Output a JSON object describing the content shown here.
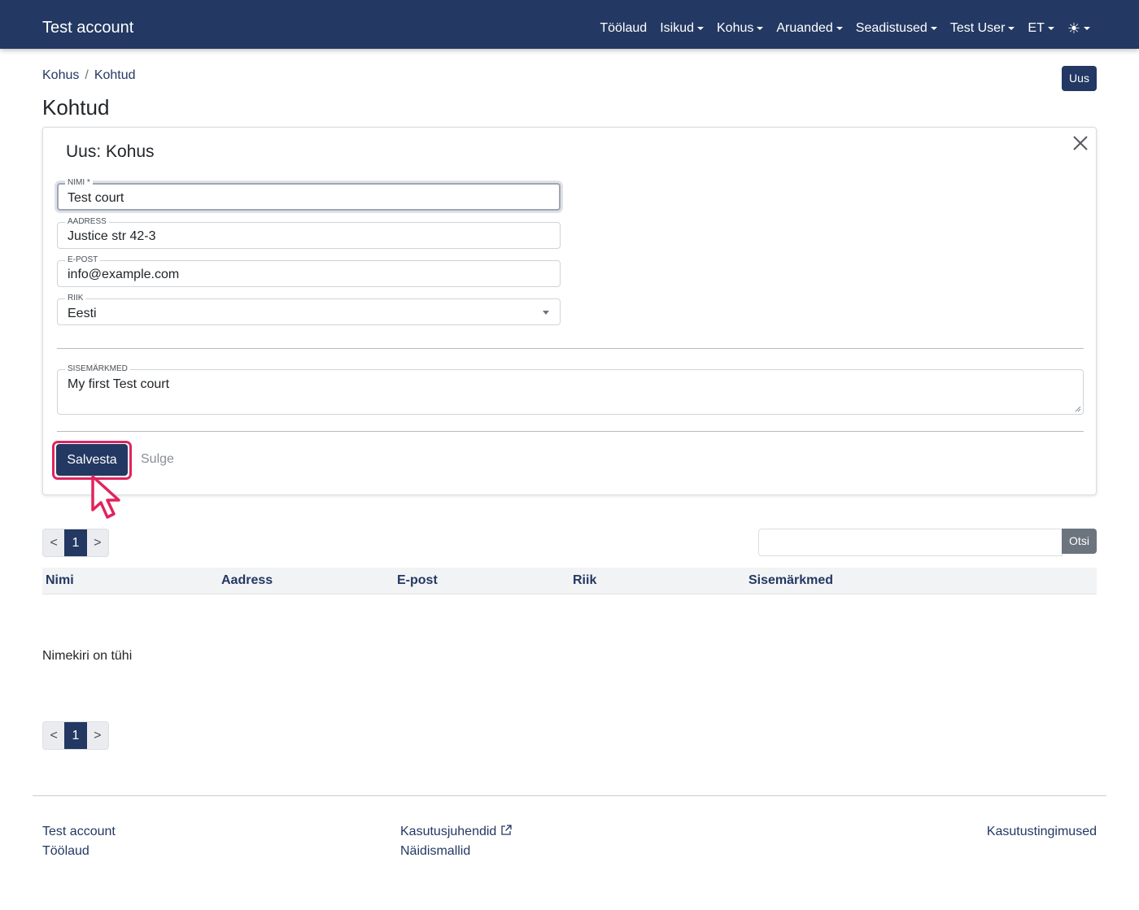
{
  "navbar": {
    "brand": "Test account",
    "items": [
      "Töölaud",
      "Isikud",
      "Kohus",
      "Aruanded",
      "Seadistused",
      "Test User",
      "ET",
      "☀"
    ]
  },
  "breadcrumb": {
    "root": "Kohus",
    "sep": "/",
    "current": "Kohtud"
  },
  "header": {
    "new_button": "Uus",
    "title": "Kohtud"
  },
  "form": {
    "title": "Uus: Kohus",
    "fields": {
      "name": {
        "label": "NIMI *",
        "value": "Test court"
      },
      "address": {
        "label": "AADRESS",
        "value": "Justice str 42-3"
      },
      "email": {
        "label": "E-POST",
        "value": "info@example.com"
      },
      "country": {
        "label": "RIIK",
        "value": "Eesti"
      },
      "notes": {
        "label": "SISEMÄRKMED",
        "value": "My first Test court"
      }
    },
    "save_label": "Salvesta",
    "close_label": "Sulge"
  },
  "pagination": {
    "prev": "<",
    "current": "1",
    "next": ">"
  },
  "search": {
    "placeholder": "",
    "button": "Otsi"
  },
  "table": {
    "columns": [
      "Nimi",
      "Aadress",
      "E-post",
      "Riik",
      "Sisemärkmed"
    ],
    "empty_text": "Nimekiri on tühi"
  },
  "footer": {
    "col1": [
      "Test account",
      "Töölaud"
    ],
    "col2": [
      "Kasutusjuhendid",
      "Näidismallid"
    ],
    "col3": [
      "Kasutustingimused"
    ]
  },
  "colors": {
    "primary": "#233862",
    "highlight": "#e0245e",
    "secondary": "#6c757d"
  },
  "icons": {
    "close": "close-icon",
    "external": "external-link-icon",
    "theme": "sun-icon",
    "cursor": "mouse-pointer-icon"
  }
}
